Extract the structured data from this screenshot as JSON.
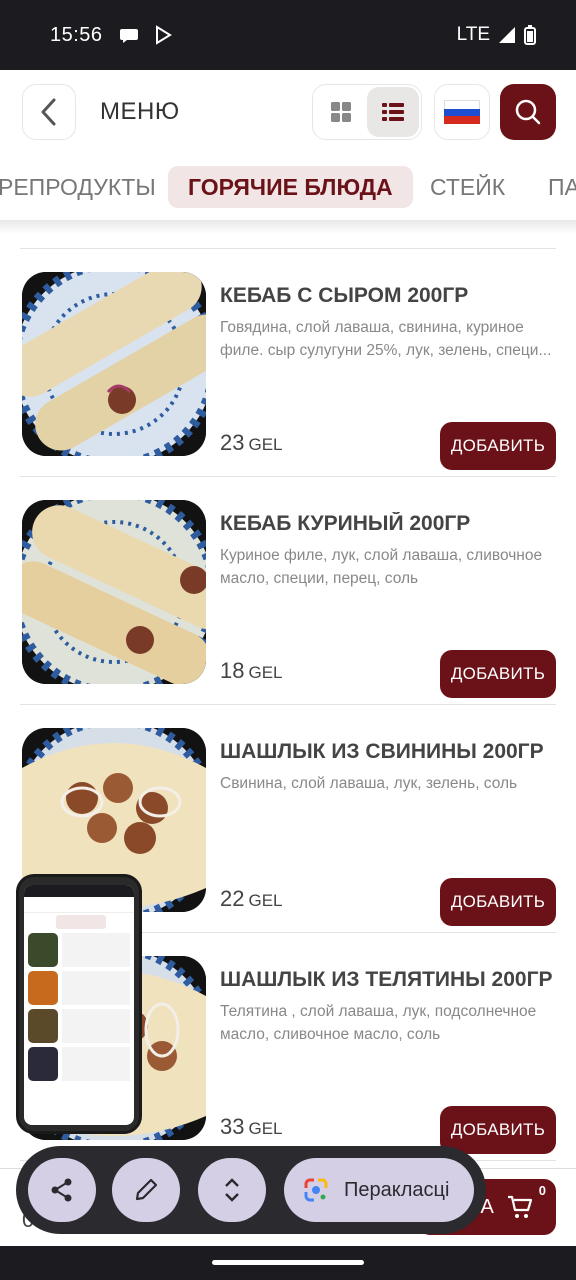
{
  "status": {
    "time": "15:56",
    "network": "LTE"
  },
  "header": {
    "title": "МЕНЮ"
  },
  "tabs": [
    {
      "label": "РЕПРОДУКТЫ",
      "active": false
    },
    {
      "label": "ГОРЯЧИЕ БЛЮДА",
      "active": true
    },
    {
      "label": "СТЕЙК",
      "active": false
    },
    {
      "label": "ПА",
      "active": false
    }
  ],
  "items": [
    {
      "name": "КЕБАБ С СЫРОМ 200ГР",
      "desc": "Говядина, слой лаваша, свинина, куриное филе. сыр сулугуни 25%, лук, зелень, специ...",
      "price": "23",
      "currency": "GEL",
      "button": "ДОБАВИТЬ"
    },
    {
      "name": "КЕБАБ КУРИНЫЙ 200ГР",
      "desc": "Куриное филе, лук, слой лаваша, сливочное масло, специи, перец, соль",
      "price": "18",
      "currency": "GEL",
      "button": "ДОБАВИТЬ"
    },
    {
      "name": "ШАШЛЫК ИЗ СВИНИНЫ 200ГР",
      "desc": "Свинина, слой лаваша, лук, зелень, соль",
      "price": "22",
      "currency": "GEL",
      "button": "ДОБАВИТЬ"
    },
    {
      "name": "ШАШЛЫК ИЗ ТЕЛЯТИНЫ 200ГР",
      "desc": "Телятина , слой лаваша, лук, подсолнечное масло, сливочное масло, соль",
      "price": "33",
      "currency": "GEL",
      "button": "ДОБАВИТЬ"
    }
  ],
  "cart": {
    "label": "НА",
    "count": "0",
    "total_prefix": "0"
  },
  "toolbar": {
    "translate_label": "Перакласці"
  },
  "colors": {
    "accent": "#6b1218",
    "active_tab_bg": "#f1e5e5"
  }
}
